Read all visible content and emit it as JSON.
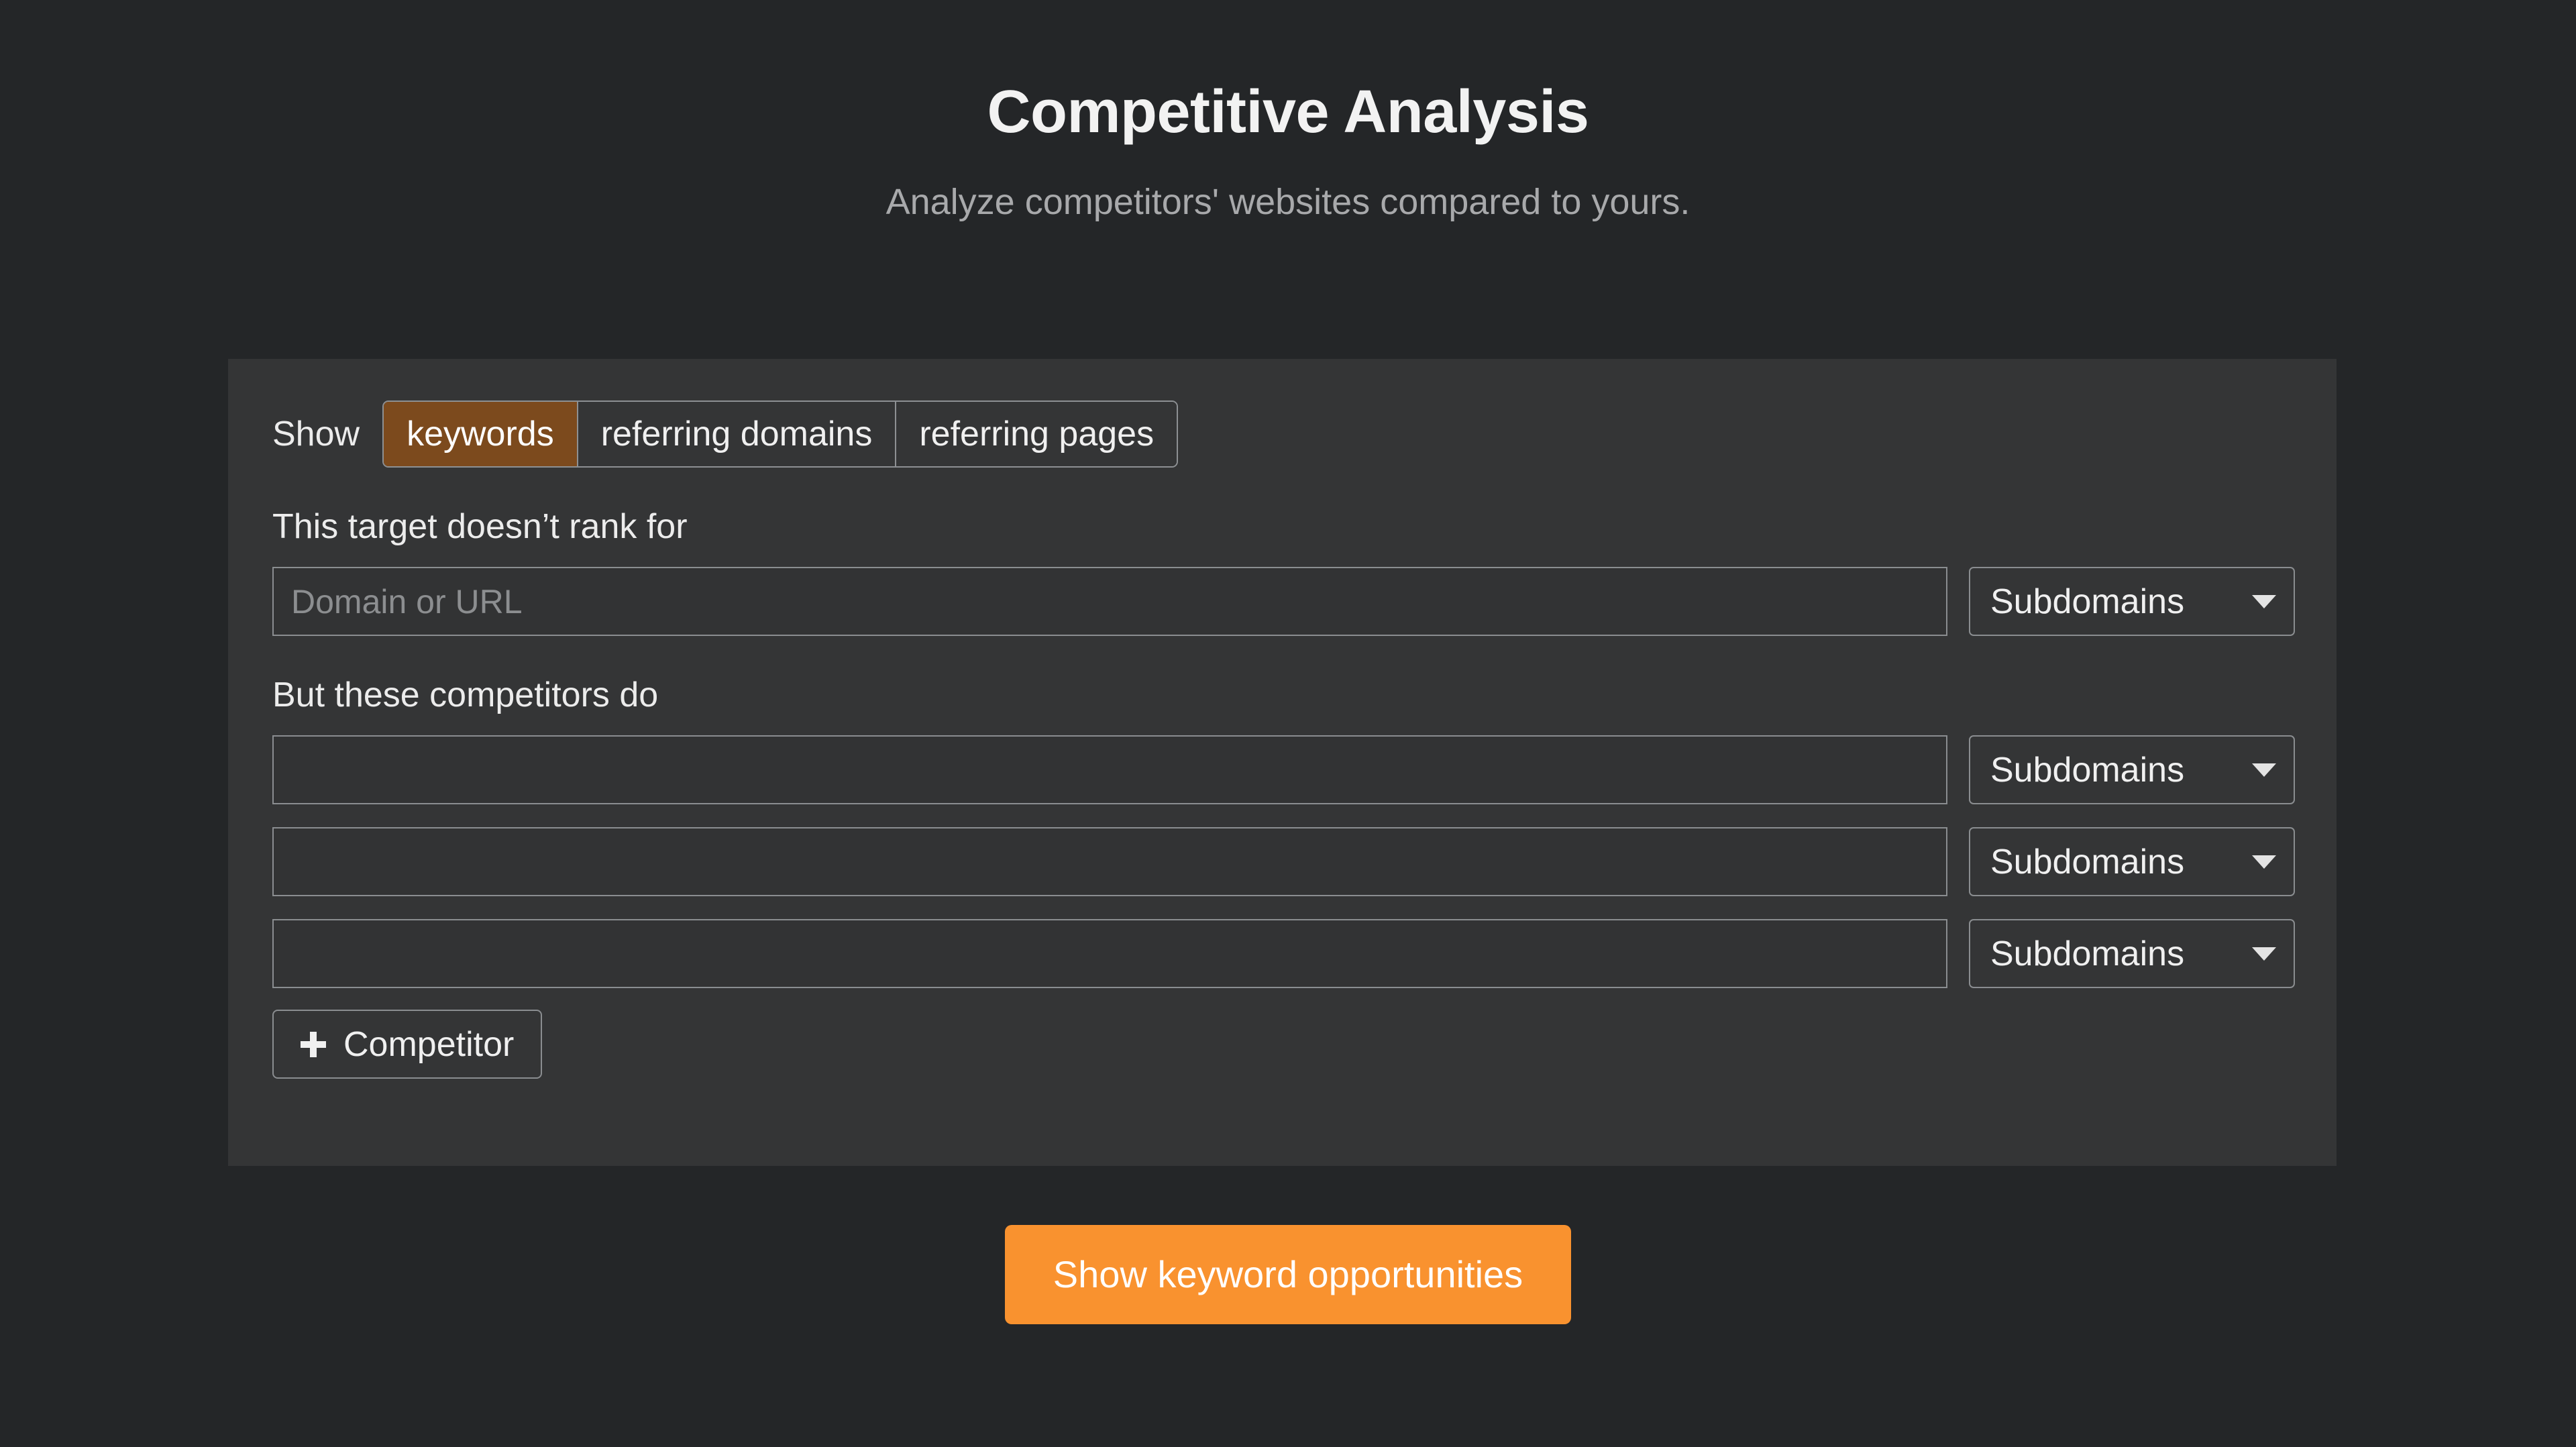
{
  "header": {
    "title": "Competitive Analysis",
    "subtitle": "Analyze competitors' websites compared to yours."
  },
  "form": {
    "show_label": "Show",
    "tabs": [
      {
        "label": "keywords",
        "active": true
      },
      {
        "label": "referring domains",
        "active": false
      },
      {
        "label": "referring pages",
        "active": false
      }
    ],
    "target": {
      "label": "This target doesn’t rank for",
      "input_value": "",
      "input_placeholder": "Domain or URL",
      "scope_label": "Subdomains"
    },
    "competitors": {
      "label": "But these competitors do",
      "rows": [
        {
          "input_value": "",
          "input_placeholder": "",
          "scope_label": "Subdomains"
        },
        {
          "input_value": "",
          "input_placeholder": "",
          "scope_label": "Subdomains"
        },
        {
          "input_value": "",
          "input_placeholder": "",
          "scope_label": "Subdomains"
        }
      ],
      "add_label": "Competitor"
    }
  },
  "cta": {
    "label": "Show keyword opportunities"
  },
  "colors": {
    "page_background": "#242628",
    "card_background": "#343536",
    "accent_orange": "#f9922f",
    "active_tab_brown": "#7c4a1d",
    "border_gray": "#8a8d90",
    "text_primary": "#ececec",
    "text_muted": "#a8a9ab"
  },
  "icons": {
    "caret": "chevron-down-icon",
    "plus": "plus-icon"
  }
}
